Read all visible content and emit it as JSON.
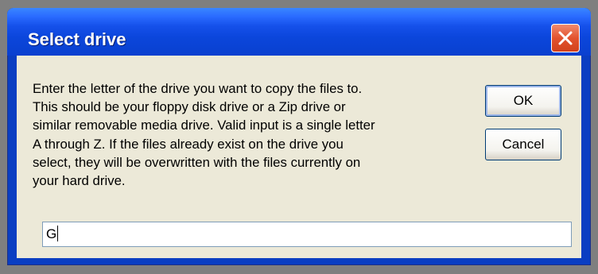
{
  "dialog": {
    "title": "Select drive",
    "close_icon": "close-icon",
    "message": "Enter the letter of the drive you want to copy the files to.\nThis should be your floppy disk drive or a Zip drive or\nsimilar removable media drive. Valid input is a single letter\nA through Z. If the files already exist on the drive you\nselect, they will be overwritten with the files currently on\nyour hard drive.",
    "ok_label": "OK",
    "cancel_label": "Cancel",
    "drive_input_value": "G"
  },
  "colors": {
    "titlebar": "#0a40cf",
    "client_background": "#ece9d8",
    "close_button": "#e3532e",
    "desktop": "#7f7f7f"
  }
}
